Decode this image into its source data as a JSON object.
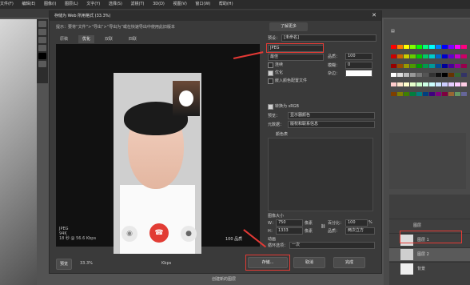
{
  "menu": {
    "items": [
      "文件(F)",
      "编辑(E)",
      "图像(I)",
      "图层(L)",
      "文字(Y)",
      "选择(S)",
      "滤镜(T)",
      "3D(D)",
      "视图(V)",
      "窗口(W)",
      "帮助(H)"
    ]
  },
  "dialog": {
    "title": "存储为 Web 所用格式 (33.3%)",
    "hint": "提示：要将“文件”>“导出”>“导出为”或在快速导出中使用此旧版本",
    "learn_more": "了解更多",
    "tabs": [
      "原稿",
      "优化",
      "双联",
      "四联"
    ],
    "active_tab": "优化",
    "image_info": "JPEG\n94K\n18 秒 @ 56.6 Kbps",
    "zoom": "100 品质",
    "bottom": {
      "preview_label": "预览",
      "zoom_value": "33.3%",
      "speed": "Kbps",
      "buttons": [
        "存储...",
        "取消",
        "完成"
      ]
    },
    "right": {
      "preset_label": "预设：",
      "preset_value": "[未命名]",
      "format_value": "JPEG",
      "quality_label": "最佳",
      "quality_value": "100",
      "quality_text": "品质：",
      "blur_label": "模糊：",
      "blur_value": "0",
      "matte_label": "杂边：",
      "progressive": "连续",
      "optimized": "优化",
      "embed_color": "嵌入颜色配置文件",
      "convert_srgb": "转换为 sRGB",
      "preview_label": "预览：",
      "preview_value": "显示器颜色",
      "metadata_label": "元数据：",
      "metadata_value": "版权和联系信息",
      "color_table": "颜色表",
      "image_size": "图像大小",
      "w_label": "W：",
      "w_value": "750",
      "h_label": "H：",
      "h_value": "1333",
      "px": "像素",
      "percent_label": "百分比：",
      "percent_value": "100",
      "percent_unit": "%",
      "quality2_label": "品质：",
      "quality2_value": "两次立方",
      "animation": "动画",
      "loop_label": "循环选项：",
      "loop_value": "一次"
    }
  },
  "colors": {
    "accent_red": "#e43b35",
    "dialog": "#3a3a3a"
  },
  "layers": {
    "items": [
      "图层",
      "图层 1",
      "图层 2",
      "背景"
    ],
    "bottom_text": "创建新的图层"
  }
}
